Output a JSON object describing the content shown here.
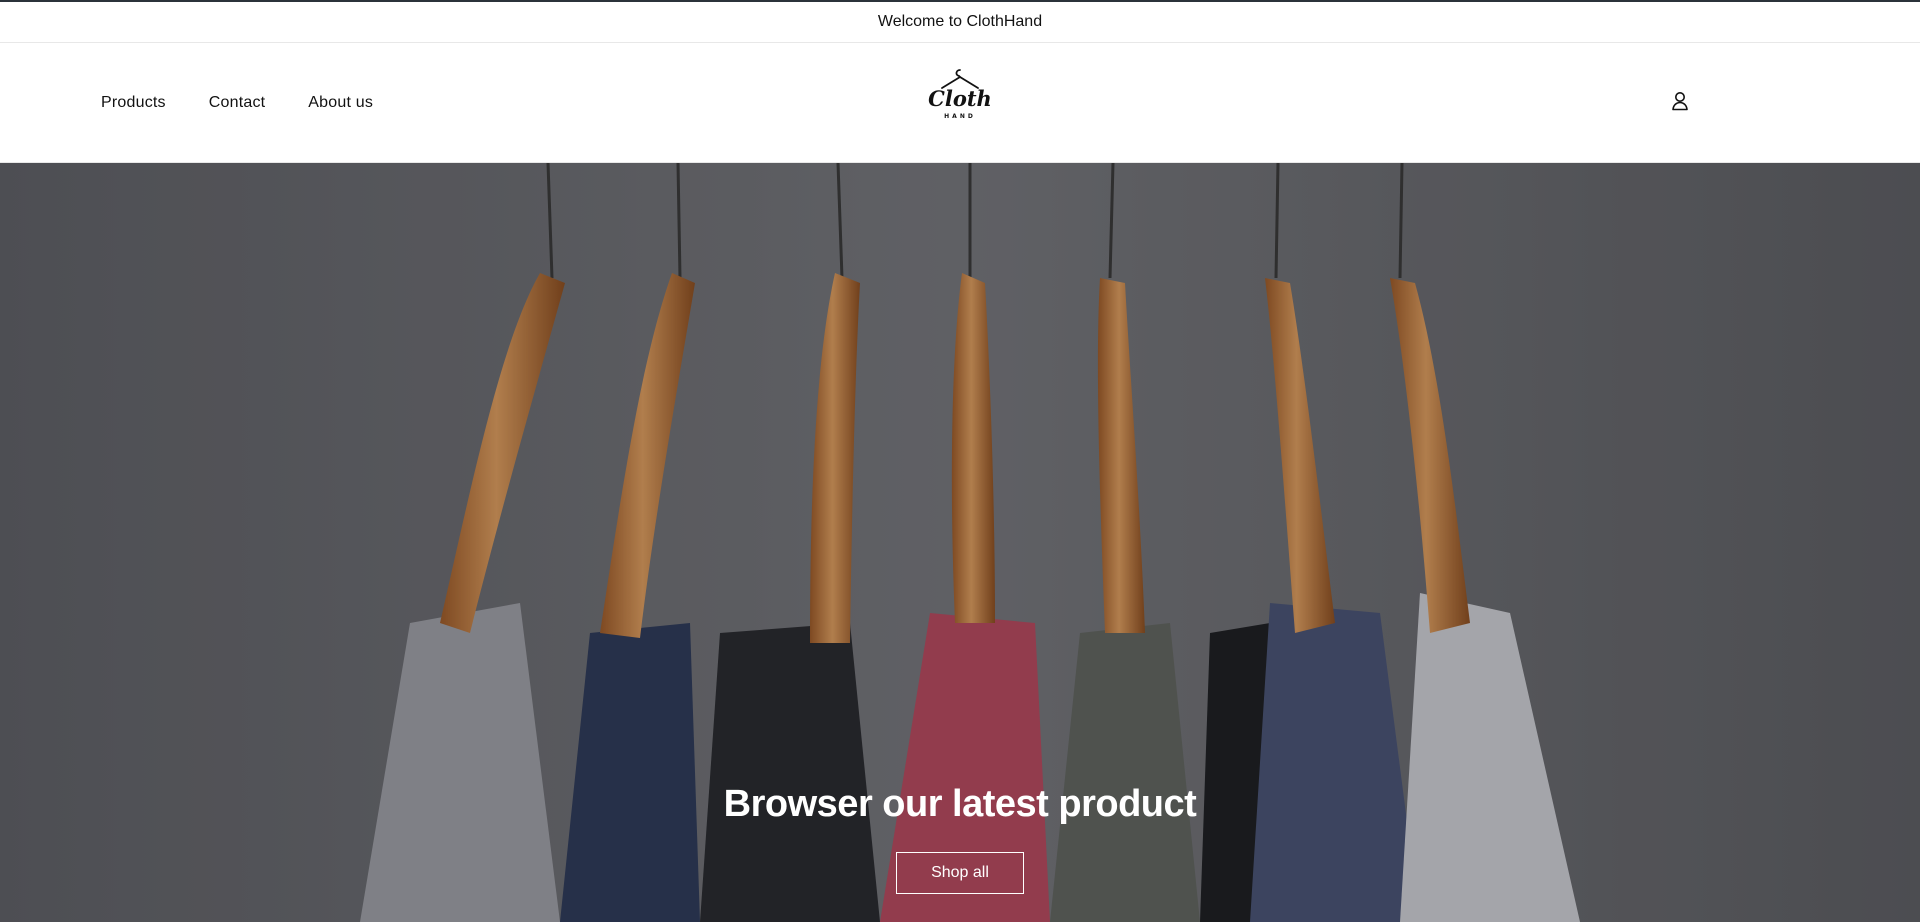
{
  "announcement": {
    "text": "Welcome to ClothHand"
  },
  "header": {
    "nav": [
      {
        "label": "Products"
      },
      {
        "label": "Contact"
      },
      {
        "label": "About us"
      }
    ],
    "logo": {
      "script": "Cloth",
      "sub": "HAND"
    },
    "account_icon": "account-icon"
  },
  "hero": {
    "title": "Browser our latest product",
    "button_label": "Shop all"
  },
  "colors": {
    "text": "#121212",
    "hero_bg": "#6a6b70",
    "hero_text": "#ffffff"
  }
}
